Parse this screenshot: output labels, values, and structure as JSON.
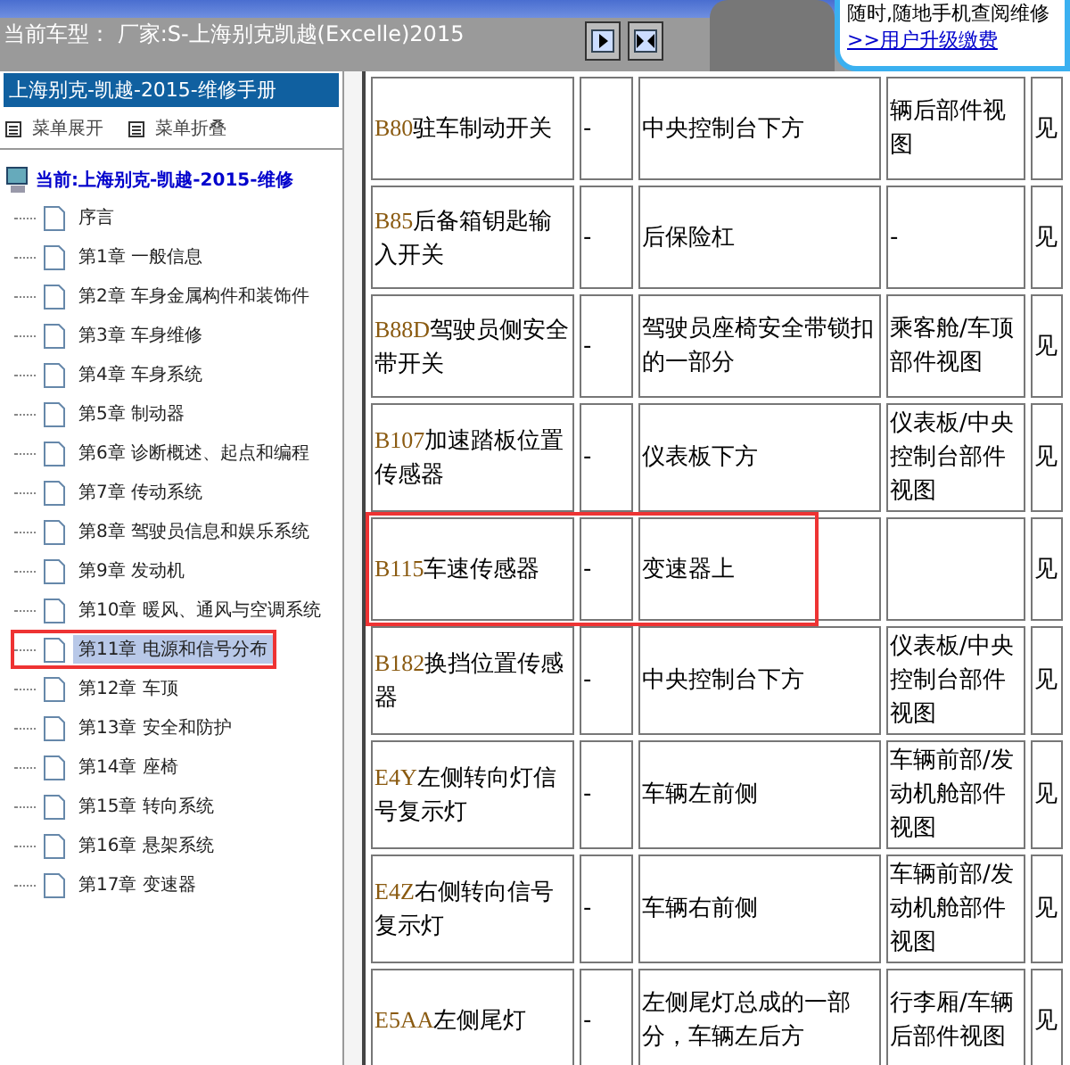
{
  "header": {
    "title": "当前车型： 厂家:S-上海别克凯越(Excelle)2015",
    "ad_text": "随时,随地手机查阅维修",
    "ad_link": ">>用户升级缴费"
  },
  "sidebar": {
    "title": "上海别克-凯越-2015-维修手册",
    "menu": [
      "菜单展开",
      "菜单折叠"
    ],
    "tree": {
      "label": "当前:上海别克-凯越-2015-维修",
      "children": [
        {
          "label": "序言",
          "selected": false,
          "highlighted": false
        },
        {
          "label": "第1章 一般信息",
          "selected": false,
          "highlighted": false
        },
        {
          "label": "第2章 车身金属构件和装饰件",
          "selected": false,
          "highlighted": false
        },
        {
          "label": "第3章 车身维修",
          "selected": false,
          "highlighted": false
        },
        {
          "label": "第4章 车身系统",
          "selected": false,
          "highlighted": false
        },
        {
          "label": "第5章 制动器",
          "selected": false,
          "highlighted": false
        },
        {
          "label": "第6章 诊断概述、起点和编程",
          "selected": false,
          "highlighted": false
        },
        {
          "label": "第7章 传动系统",
          "selected": false,
          "highlighted": false
        },
        {
          "label": "第8章 驾驶员信息和娱乐系统",
          "selected": false,
          "highlighted": false
        },
        {
          "label": "第9章 发动机",
          "selected": false,
          "highlighted": false
        },
        {
          "label": "第10章 暖风、通风与空调系统",
          "selected": false,
          "highlighted": false
        },
        {
          "label": "第11章 电源和信号分布",
          "selected": true,
          "highlighted": true
        },
        {
          "label": "第12章 车顶",
          "selected": false,
          "highlighted": false
        },
        {
          "label": "第13章 安全和防护",
          "selected": false,
          "highlighted": false
        },
        {
          "label": "第14章 座椅",
          "selected": false,
          "highlighted": false
        },
        {
          "label": "第15章 转向系统",
          "selected": false,
          "highlighted": false
        },
        {
          "label": "第16章 悬架系统",
          "selected": false,
          "highlighted": false
        },
        {
          "label": "第17章 变速器",
          "selected": false,
          "highlighted": false
        }
      ]
    }
  },
  "table": {
    "rows": [
      {
        "code": "B80",
        "name": "驻车制动开关",
        "column_2": "-",
        "column_3": "中央控制台下方",
        "column_4": "辆后部件视图",
        "column_5": "见",
        "highlighted": false
      },
      {
        "code": "B85",
        "name": "后备箱钥匙输入开关",
        "column_2": "-",
        "column_3": "后保险杠",
        "column_4": "-",
        "column_5": "见",
        "highlighted": false
      },
      {
        "code": "B88D",
        "name": "驾驶员侧安全带开关",
        "column_2": "-",
        "column_3": "驾驶员座椅安全带锁扣的一部分",
        "column_4": "乘客舱/车顶部件视图",
        "column_5": "见",
        "highlighted": false
      },
      {
        "code": "B107",
        "name": "加速踏板位置传感器",
        "column_2": "-",
        "column_3": "仪表板下方",
        "column_4": "仪表板/中央控制台部件视图",
        "column_5": "见",
        "highlighted": false
      },
      {
        "code": "B115",
        "name": "车速传感器",
        "column_2": "-",
        "column_3": "变速器上",
        "column_4": "",
        "column_5": "见",
        "highlighted": true
      },
      {
        "code": "B182",
        "name": "换挡位置传感器",
        "column_2": "-",
        "column_3": "中央控制台下方",
        "column_4": "仪表板/中央控制台部件视图",
        "column_5": "见",
        "highlighted": false
      },
      {
        "code": "E4Y",
        "name": "左侧转向灯信号复示灯",
        "column_2": "-",
        "column_3": "车辆左前侧",
        "column_4": "车辆前部/发动机舱部件视图",
        "column_5": "见",
        "highlighted": false
      },
      {
        "code": "E4Z",
        "name": "右侧转向信号复示灯",
        "column_2": "-",
        "column_3": "车辆右前侧",
        "column_4": "车辆前部/发动机舱部件视图",
        "column_5": "见",
        "highlighted": false
      },
      {
        "code": "E5AA",
        "name": "左侧尾灯",
        "column_2": "-",
        "column_3": "左侧尾灯总成的一部分，车辆左后方",
        "column_4": "行李厢/车辆后部件视图",
        "column_5": "见",
        "highlighted": false
      }
    ]
  }
}
